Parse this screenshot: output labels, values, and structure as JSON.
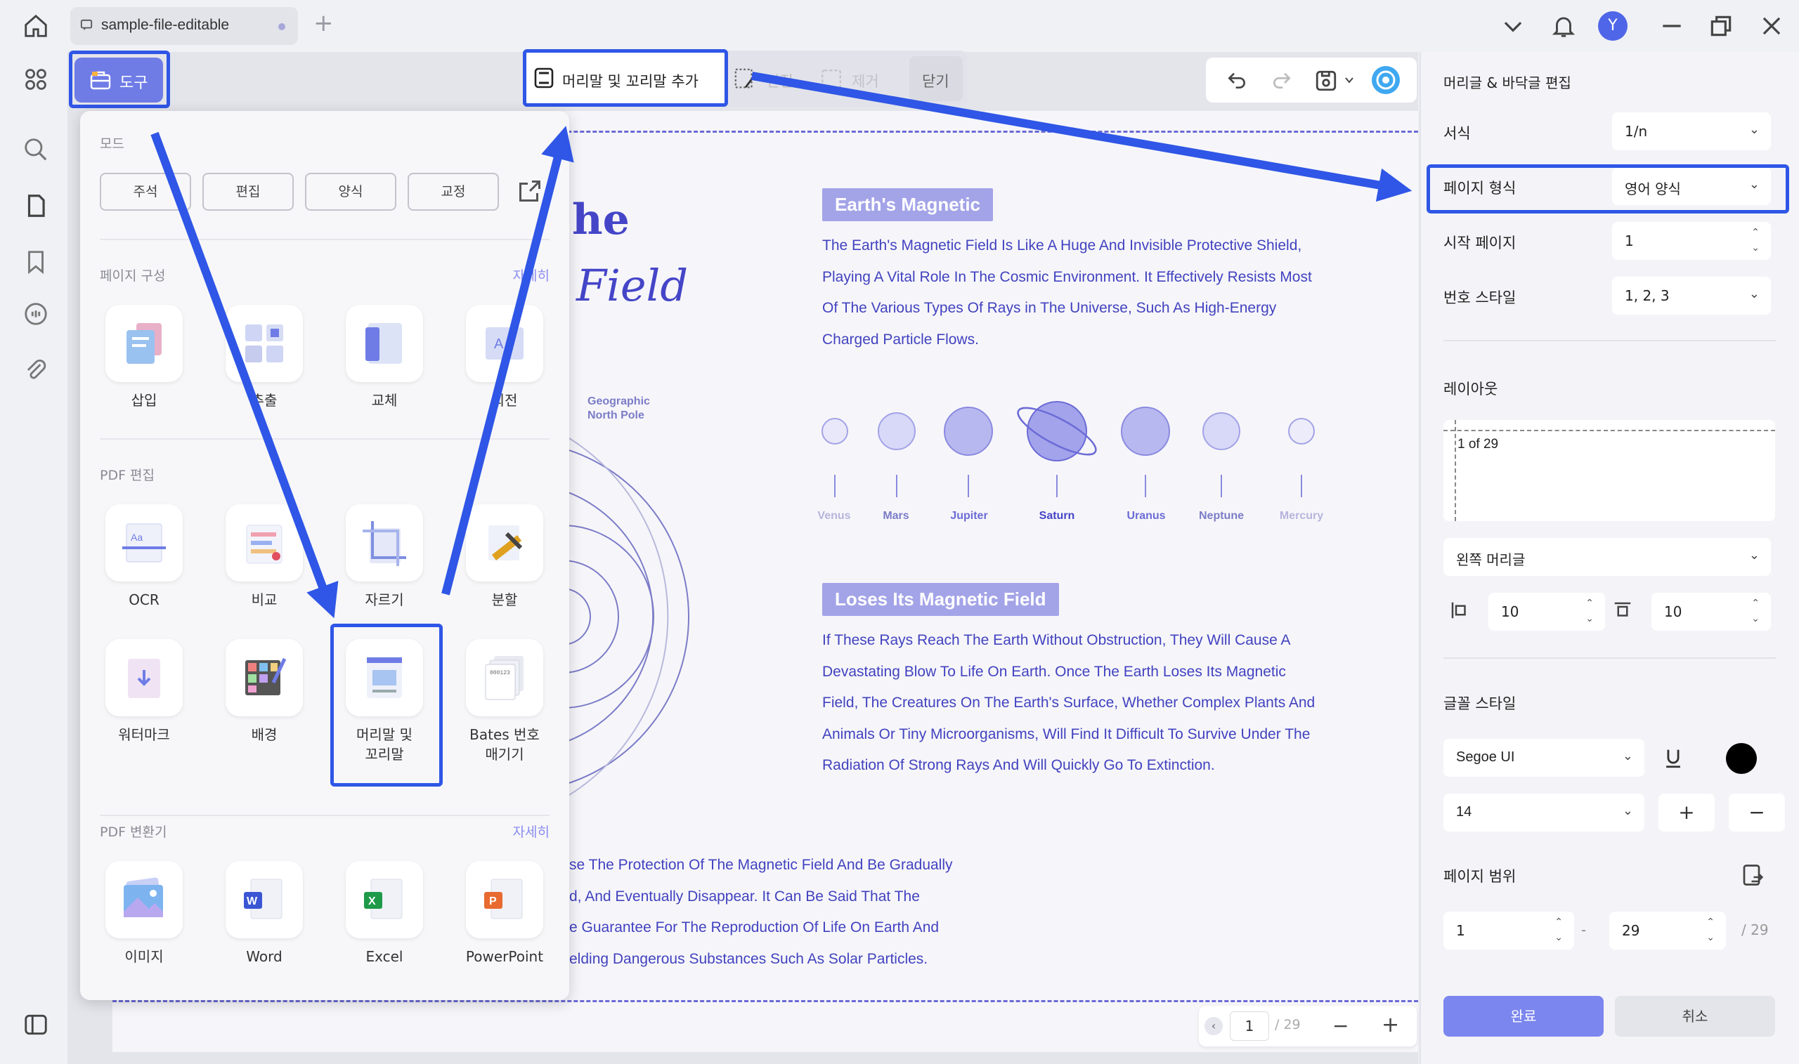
{
  "titlebar": {
    "tab_title": "sample-file-editable",
    "avatar_initial": "Y"
  },
  "toolbar": {
    "tools_label": "도구",
    "header_footer_label": "머리말 및 꼬리말 추가",
    "edit_label": "편집",
    "remove_label": "제거",
    "close_label": "닫기"
  },
  "popup": {
    "mode_title": "모드",
    "modes": [
      "주석",
      "편집",
      "양식",
      "교정"
    ],
    "page_section": {
      "title": "페이지 구성",
      "more": "자세히",
      "items": [
        "삽입",
        "추출",
        "교체",
        "회전"
      ]
    },
    "pdf_edit_section": {
      "title": "PDF 편집",
      "items": [
        "OCR",
        "비교",
        "자르기",
        "분할",
        "워터마크",
        "배경",
        "머리말 및\n꼬리말",
        "Bates 번호\n매기기"
      ]
    },
    "converter_section": {
      "title": "PDF 변환기",
      "more": "자세히",
      "items": [
        "이미지",
        "Word",
        "Excel",
        "PowerPoint"
      ]
    }
  },
  "document": {
    "title_line1": "he",
    "title_line2": "Field",
    "tag1": "Earth's Magnetic",
    "para1": [
      "The Earth's Magnetic Field Is Like A Huge And Invisible Protective Shield,",
      "Playing A Vital Role In The Cosmic Environment. It Effectively Resists Most",
      "Of The Various Types Of Rays in The Universe, Such As High-Energy",
      "Charged Particle Flows."
    ],
    "geo_label": "Geographic\nNorth Pole",
    "planets": [
      "Venus",
      "Mars",
      "Jupiter",
      "Saturn",
      "Uranus",
      "Neptune",
      "Mercury"
    ],
    "tag2": "Loses Its Magnetic Field",
    "para2": [
      "If These Rays Reach The Earth Without Obstruction, They Will Cause A",
      "Devastating Blow To Life On Earth. Once The Earth Loses Its Magnetic",
      "Field, The Creatures On The Earth's Surface, Whether Complex Plants And",
      "Animals Or Tiny Microorganisms, Will Find It Difficult To Survive Under The",
      "Radiation Of Strong Rays And Will Quickly Go To Extinction."
    ],
    "para3": [
      "se The Protection Of The Magnetic Field And Be Gradually",
      "d, And Eventually Disappear. It Can Be Said That The",
      "e Guarantee For The Reproduction Of Life On Earth And",
      "elding Dangerous Substances Such As Solar Particles."
    ]
  },
  "pager": {
    "current": "1",
    "total": "/ 29"
  },
  "panel": {
    "title": "머리글 & 바닥글 편집",
    "format_label": "서식",
    "format_value": "1/n",
    "page_format_label": "페이지 형식",
    "page_format_value": "영어 양식",
    "start_page_label": "시작 페이지",
    "start_page_value": "1",
    "number_style_label": "번호 스타일",
    "number_style_value": "1, 2, 3",
    "layout_label": "레이아웃",
    "preview_text": "1 of 29",
    "position_value": "왼쪽 머리글",
    "margin_left": "10",
    "margin_top": "10",
    "font_style_label": "글꼴 스타일",
    "font_value": "Segoe UI",
    "font_size_value": "14",
    "font_color": "#000000",
    "page_range_label": "페이지 범위",
    "range_from": "1",
    "range_dash": "-",
    "range_to": "29",
    "range_total": "/ 29",
    "done_label": "완료",
    "cancel_label": "취소"
  },
  "colors": {
    "accent": "#6f7ce6",
    "highlight": "#2f56e6",
    "doc_text": "#4242c0"
  }
}
